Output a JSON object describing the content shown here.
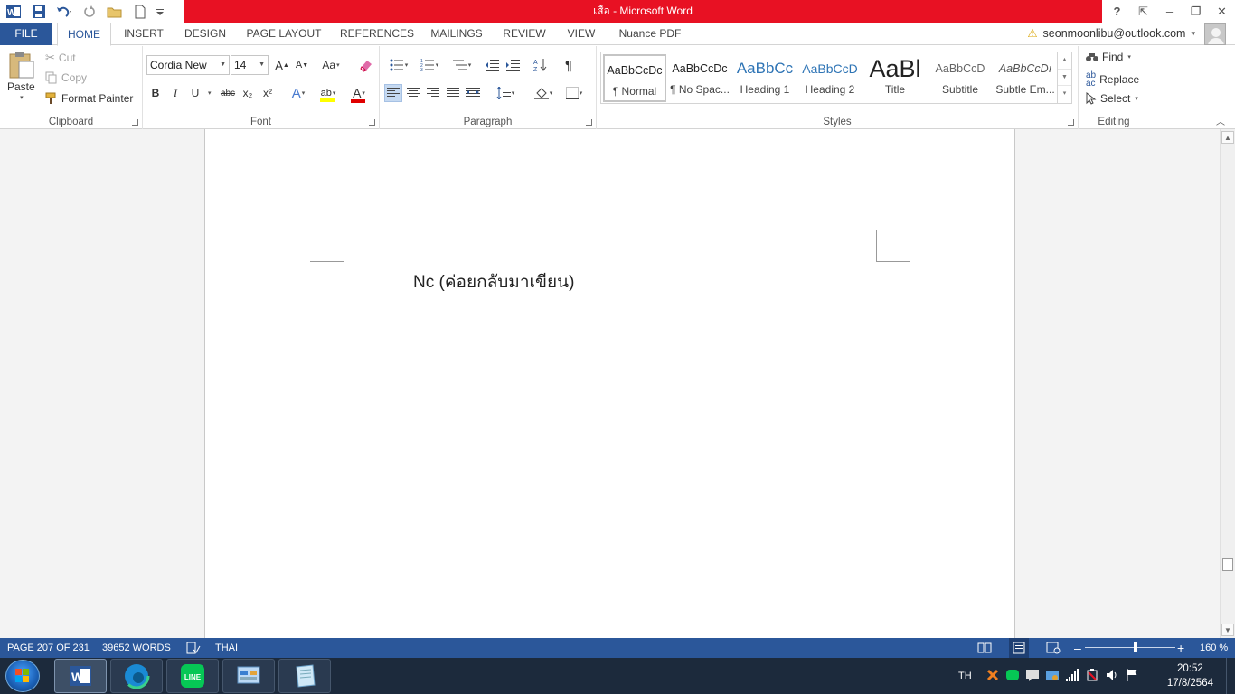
{
  "window": {
    "title": "เสือ -  Microsoft Word",
    "help": "?",
    "ribbon_display": "⇱",
    "minimize": "–",
    "restore": "❐",
    "close": "✕"
  },
  "tabs": [
    {
      "label": "FILE"
    },
    {
      "label": "HOME"
    },
    {
      "label": "INSERT"
    },
    {
      "label": "DESIGN"
    },
    {
      "label": "PAGE LAYOUT"
    },
    {
      "label": "REFERENCES"
    },
    {
      "label": "MAILINGS"
    },
    {
      "label": "REVIEW"
    },
    {
      "label": "VIEW"
    },
    {
      "label": "Nuance PDF"
    }
  ],
  "account": {
    "email": "seonmoonlibu@outlook.com",
    "warning": "⚠",
    "dropdown": "▾"
  },
  "clipboard": {
    "group_label": "Clipboard",
    "paste": "Paste",
    "cut": "Cut",
    "copy": "Copy",
    "format_painter": "Format Painter"
  },
  "font": {
    "group_label": "Font",
    "font_name": "Cordia New",
    "font_size": "14",
    "grow": "A",
    "shrink": "A",
    "change_case": "Aa",
    "bold": "B",
    "italic": "I",
    "underline": "U",
    "strike": "abc",
    "subscript": "x₂",
    "superscript": "x²",
    "text_effects": "A",
    "highlight": "ab",
    "font_color": "A"
  },
  "paragraph": {
    "group_label": "Paragraph",
    "pilcrow": "¶"
  },
  "styles": {
    "group_label": "Styles",
    "items": [
      {
        "preview": "AaBbCcDc",
        "name": "¶ Normal"
      },
      {
        "preview": "AaBbCcDc",
        "name": "¶ No Spac..."
      },
      {
        "preview": "AaBbCc",
        "name": "Heading 1"
      },
      {
        "preview": "AaBbCcD",
        "name": "Heading 2"
      },
      {
        "preview": "AaBl",
        "name": "Title"
      },
      {
        "preview": "AaBbCcD",
        "name": "Subtitle"
      },
      {
        "preview": "AaBbCcDı",
        "name": "Subtle Em..."
      }
    ]
  },
  "editing": {
    "group_label": "Editing",
    "find": "Find",
    "replace": "Replace",
    "select": "Select"
  },
  "document": {
    "text": "Nc (ค่อยกลับมาเขียน)"
  },
  "statusbar": {
    "page": "PAGE 207 OF 231",
    "words": "39652 WORDS",
    "language": "THAI",
    "zoom_minus": "–",
    "zoom_plus": "+",
    "zoom": "160 %"
  },
  "taskbar": {
    "lang": "TH",
    "time": "20:52",
    "date": "17/8/2564",
    "line_label": "LINE",
    "word_label": "W"
  },
  "colors": {
    "word_blue": "#2b579a",
    "title_red": "#e81123",
    "taskbar": "#1c2a3c"
  }
}
